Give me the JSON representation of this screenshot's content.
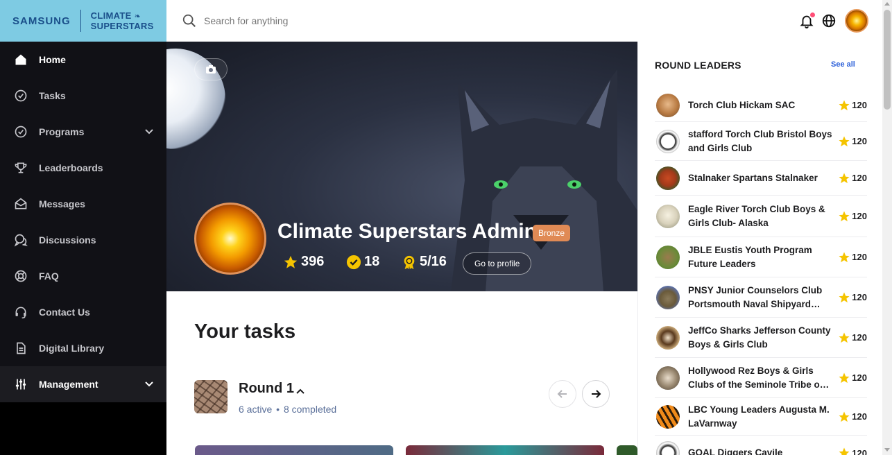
{
  "brand": {
    "samsung": "SAMSUNG",
    "climate_line1": "CLIMATE",
    "climate_line2": "SUPERSTARS",
    "bg_color": "#7ecbe3"
  },
  "sidebar": {
    "items": [
      {
        "label": "Home",
        "icon": "home-icon",
        "active": true
      },
      {
        "label": "Tasks",
        "icon": "check-circle-icon"
      },
      {
        "label": "Programs",
        "icon": "check-circle-icon",
        "expandable": true
      },
      {
        "label": "Leaderboards",
        "icon": "trophy-icon"
      },
      {
        "label": "Messages",
        "icon": "envelope-open-icon"
      },
      {
        "label": "Discussions",
        "icon": "chat-bubbles-icon"
      },
      {
        "label": "FAQ",
        "icon": "lifebuoy-icon"
      },
      {
        "label": "Contact Us",
        "icon": "headset-icon"
      },
      {
        "label": "Digital Library",
        "icon": "document-icon"
      },
      {
        "label": "Management",
        "icon": "sliders-icon",
        "expandable": true
      }
    ]
  },
  "search": {
    "placeholder": "Search for anything"
  },
  "profile": {
    "name": "Climate Superstars Admin",
    "badge": "Bronze",
    "points": "396",
    "tasks_completed": "18",
    "awards": "5/16",
    "go_to_profile": "Go to profile"
  },
  "tasks": {
    "title": "Your tasks",
    "round": {
      "title": "Round 1",
      "active": "6 active",
      "separator": "•",
      "completed": "8 completed"
    }
  },
  "leaders": {
    "title": "ROUND LEADERS",
    "see_all": "See all",
    "items": [
      {
        "name": "Torch Club Hickam SAC",
        "points": "120"
      },
      {
        "name": "stafford Torch Club Bristol Boys and Girls Club",
        "points": "120"
      },
      {
        "name": "Stalnaker Spartans Stalnaker",
        "points": "120"
      },
      {
        "name": "Eagle River Torch Club Boys & Girls Club- Alaska",
        "points": "120"
      },
      {
        "name": "JBLE Eustis Youth Program Future Leaders",
        "points": "120"
      },
      {
        "name": "PNSY Junior Counselors Club Portsmouth Naval Shipyard…",
        "points": "120"
      },
      {
        "name": "JeffCo Sharks Jefferson County Boys & Girls Club",
        "points": "120"
      },
      {
        "name": "Hollywood Rez Boys & Girls Clubs of the Seminole Tribe o…",
        "points": "120"
      },
      {
        "name": "LBC Young Leaders Augusta M. LaVarnway",
        "points": "120"
      },
      {
        "name": "GOAL Diggers Cavile",
        "points": "120"
      }
    ]
  },
  "colors": {
    "star": "#f5c400",
    "badge": "#e08a55",
    "link": "#2b5fd9",
    "notification": "#ff4f77"
  }
}
